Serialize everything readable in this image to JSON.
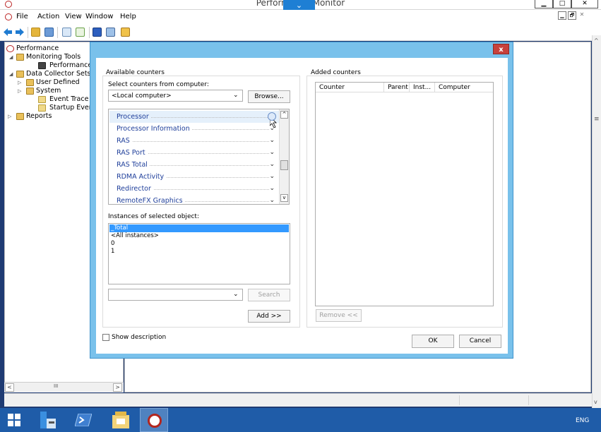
{
  "window": {
    "title": "Performance Monitor",
    "down_tab_glyph": "⌄",
    "min_glyph": "▁",
    "max_glyph": "□",
    "close_glyph": "✕"
  },
  "menu": {
    "items": [
      "File",
      "Action",
      "View",
      "Window",
      "Help"
    ],
    "doc_controls": [
      "▁",
      "🗗",
      "✕"
    ]
  },
  "tree": {
    "items": [
      {
        "label": "Performance",
        "icon": "perfmon-icon"
      },
      {
        "label": "Monitoring Tools",
        "icon": "folder-tools-icon"
      },
      {
        "label": "Performance Monitor",
        "icon": "chart-icon"
      },
      {
        "label": "Data Collector Sets",
        "icon": "collector-icon"
      },
      {
        "label": "User Defined",
        "icon": "folder-user-icon"
      },
      {
        "label": "System",
        "icon": "folder-system-icon"
      },
      {
        "label": "Event Trace Sessions",
        "icon": "trace-icon"
      },
      {
        "label": "Startup Event Trace Sessions",
        "icon": "trace-icon"
      },
      {
        "label": "Reports",
        "icon": "reports-icon"
      }
    ],
    "scroll_thumb": "III"
  },
  "dialog": {
    "close_label": "x",
    "available_counters_label": "Available counters",
    "select_from_computer_label": "Select counters from computer:",
    "computer_value": "<Local computer>",
    "browse_label": "Browse...",
    "counters": [
      "Processor",
      "Processor Information",
      "RAS",
      "RAS Port",
      "RAS Total",
      "RDMA Activity",
      "Redirector",
      "RemoteFX Graphics"
    ],
    "instances_label": "Instances of selected object:",
    "instances": [
      "_Total",
      "<All instances>",
      "0",
      "1"
    ],
    "search_value": "",
    "search_label": "Search",
    "add_label": "Add >>",
    "added_counters_label": "Added counters",
    "added_columns": [
      "Counter",
      "Parent",
      "Inst...",
      "Computer"
    ],
    "remove_label": "Remove <<",
    "show_description_label": "Show description",
    "ok_label": "OK",
    "cancel_label": "Cancel"
  },
  "taskbar": {
    "language": "ENG"
  },
  "colors": {
    "dialog_frame": "#79c1eb",
    "selection": "#3399ff",
    "counter_text": "#1e3e9a",
    "taskbar": "#1f5ca8",
    "down_tab": "#1e7fd4",
    "close_red": "#c7413c"
  }
}
